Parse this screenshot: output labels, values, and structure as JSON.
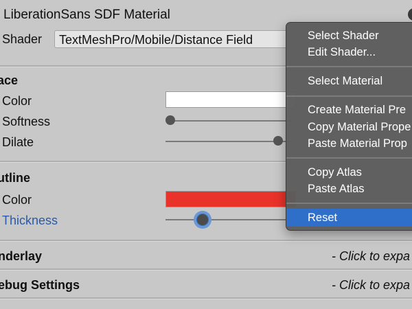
{
  "header": {
    "title": "LiberationSans SDF Material",
    "shader_label": "Shader",
    "shader_value": "TextMeshPro/Mobile/Distance Field"
  },
  "face": {
    "title": "ace",
    "color_label": "Color",
    "color_value": "#ffffff",
    "softness_label": "Softness",
    "dilate_label": "Dilate"
  },
  "outline": {
    "title": "utline",
    "color_label": "Color",
    "color_value": "#e8322a",
    "thickness_label": "Thickness"
  },
  "foldouts": [
    {
      "title": "nderlay",
      "hint": "- Click to expa"
    },
    {
      "title": "ebug Settings",
      "hint": "- Click to expa"
    }
  ],
  "context_menu": {
    "items": [
      "Select Shader",
      "Edit Shader...",
      "Select Material",
      "Create Material Pre",
      "Copy Material Prope",
      "Paste Material Prop",
      "Copy Atlas",
      "Paste Atlas",
      "Reset"
    ],
    "highlighted": "Reset",
    "highlight_color": "#2f6fc9"
  }
}
